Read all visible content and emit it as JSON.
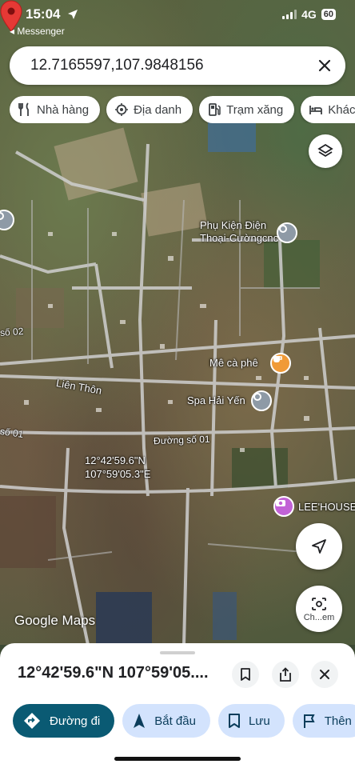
{
  "status": {
    "time": "15:04",
    "back_app": "◂ Messenger",
    "network": "4G",
    "battery": "60"
  },
  "search": {
    "value": "12.7165597,107.9848156"
  },
  "chips": [
    {
      "label": "Nhà hàng",
      "icon": "restaurant-icon"
    },
    {
      "label": "Địa danh",
      "icon": "landmark-icon"
    },
    {
      "label": "Trạm xăng",
      "icon": "gas-station-icon"
    },
    {
      "label": "Khách",
      "icon": "hotel-icon"
    }
  ],
  "map": {
    "places": {
      "phu_kien": "Phụ Kiện Điện\nThoại-Cườngcnc",
      "me_ca_phe": "Mê cà phê",
      "spa": "Spa Hải Yến",
      "leehouse": "LEE'HOUSE"
    },
    "roads": {
      "duong_so_02": "số 02",
      "lien_thon": "Liên Thôn",
      "duong_so_01_left": "số 01",
      "duong_so_01": "Đường số 01"
    },
    "pin_coords": {
      "lat": "12°42'59.6\"N",
      "lng": "107°59'05.3\"E"
    },
    "brand": "Google Maps",
    "lens_label": "Ch...em"
  },
  "sheet": {
    "title": "12°42'59.6\"N 107°59'05....",
    "actions": {
      "directions": "Đường đi",
      "start": "Bắt đầu",
      "save": "Lưu",
      "more": "Thên"
    }
  },
  "colors": {
    "primary_action": "#0a5a73",
    "secondary_action": "#d3e3fd",
    "pin": "#e53935"
  }
}
